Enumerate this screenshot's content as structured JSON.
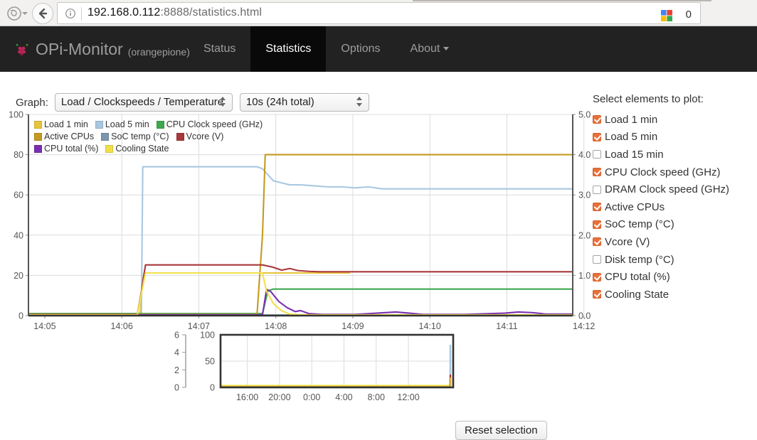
{
  "browser": {
    "url_host": "192.168.0.112",
    "url_rest": ":8888/statistics.html",
    "badge_count": "0",
    "icons": {
      "firefox": "firefox-logo-icon",
      "back": "back-arrow-icon",
      "info": "page-info-icon",
      "extension": "extension-icon"
    }
  },
  "navbar": {
    "brand": "OPi-Monitor",
    "brand_sub": "(orangepione)",
    "items": [
      {
        "label": "Status",
        "active": false
      },
      {
        "label": "Statistics",
        "active": true
      },
      {
        "label": "Options",
        "active": false
      },
      {
        "label": "About",
        "active": false,
        "caret": true
      }
    ]
  },
  "controls": {
    "graph_label": "Graph:",
    "graph_select": "Load / Clockspeeds / Temperature",
    "interval_select": "10s (24h total)"
  },
  "plot_selector": {
    "title": "Select elements to plot:",
    "items": [
      {
        "label": "Load 1 min",
        "checked": true
      },
      {
        "label": "Load 5 min",
        "checked": true
      },
      {
        "label": "Load 15 min",
        "checked": false
      },
      {
        "label": "CPU Clock speed (GHz)",
        "checked": true
      },
      {
        "label": "DRAM Clock speed (GHz)",
        "checked": false
      },
      {
        "label": "Active CPUs",
        "checked": true
      },
      {
        "label": "SoC temp (°C)",
        "checked": true
      },
      {
        "label": "Vcore (V)",
        "checked": true
      },
      {
        "label": "Disk temp (°C)",
        "checked": false
      },
      {
        "label": "CPU total (%)",
        "checked": true
      },
      {
        "label": "Cooling State",
        "checked": true
      }
    ]
  },
  "buttons": {
    "reset_selection": "Reset selection"
  },
  "chart_data": {
    "type": "line",
    "title": "",
    "xlabel": "",
    "ylabel": "",
    "grid": true,
    "legend_position": "top-left",
    "x_ticks": [
      "14:05",
      "14:06",
      "14:07",
      "14:08",
      "14:09",
      "14:10",
      "14:11",
      "14:12"
    ],
    "y_left_ticks": [
      "0",
      "20",
      "40",
      "60",
      "80",
      "100"
    ],
    "y_right_ticks": [
      "0.0",
      "1.0",
      "2.0",
      "3.0",
      "4.0",
      "5.0"
    ],
    "ylim_left": [
      0,
      100
    ],
    "ylim_right": [
      0.0,
      5.0
    ],
    "xlim": [
      "14:04:30",
      "14:12:40"
    ],
    "series": [
      {
        "name": "Load 1 min",
        "color": "#e8c33c",
        "axis": "right",
        "points": [
          [
            0,
            0.02
          ],
          [
            0.24,
            0.02
          ],
          [
            0.3,
            0.03
          ],
          [
            0.31,
            0.02
          ],
          [
            0.33,
            0.04
          ],
          [
            0.35,
            0.02
          ],
          [
            0.4,
            0.05
          ],
          [
            0.41,
            0.03
          ],
          [
            0.42,
            0.9
          ],
          [
            0.425,
            1.06
          ],
          [
            0.43,
            1.06
          ],
          [
            0.5,
            1.06
          ],
          [
            0.6,
            1.06
          ],
          [
            0.7,
            1.06
          ],
          [
            0.8,
            1.06
          ],
          [
            0.9,
            1.06
          ],
          [
            1.0,
            1.06
          ],
          [
            1.05,
            1.06
          ],
          [
            1.08,
            1.06
          ],
          [
            1.1,
            1.06
          ],
          [
            1.12,
            1.06
          ],
          [
            1.15,
            1.06
          ],
          [
            1.18,
            1.06
          ]
        ]
      },
      {
        "name": "Load 5 min",
        "color": "#a8c8e0",
        "axis": "left",
        "points": [
          [
            0,
            0.4
          ],
          [
            0.24,
            0.4
          ],
          [
            0.3,
            0.4
          ],
          [
            0.4,
            0.4
          ],
          [
            0.415,
            0.4
          ],
          [
            0.42,
            74
          ],
          [
            0.43,
            74
          ],
          [
            0.5,
            74
          ],
          [
            0.6,
            74
          ],
          [
            0.7,
            74
          ],
          [
            0.8,
            74
          ],
          [
            0.84,
            74
          ],
          [
            0.86,
            73
          ],
          [
            0.88,
            70
          ],
          [
            0.9,
            67
          ],
          [
            0.93,
            66
          ],
          [
            0.96,
            65
          ],
          [
            1.0,
            65
          ],
          [
            1.05,
            64.5
          ],
          [
            1.1,
            64
          ],
          [
            1.15,
            64
          ],
          [
            1.2,
            63.5
          ],
          [
            1.25,
            64
          ],
          [
            1.3,
            63
          ],
          [
            1.35,
            63
          ],
          [
            1.4,
            63
          ],
          [
            1.45,
            63
          ],
          [
            1.5,
            63
          ],
          [
            1.6,
            63
          ],
          [
            1.7,
            63
          ],
          [
            1.8,
            63
          ],
          [
            1.9,
            63
          ],
          [
            2.0,
            63
          ]
        ]
      },
      {
        "name": "CPU Clock speed (GHz)",
        "color": "#3ea84f",
        "axis": "right",
        "points": [
          [
            0,
            0.05
          ],
          [
            0.4,
            0.05
          ],
          [
            0.86,
            0.05
          ],
          [
            0.88,
            0.62
          ],
          [
            0.9,
            0.66
          ],
          [
            0.93,
            0.66
          ],
          [
            1.0,
            0.66
          ],
          [
            1.2,
            0.66
          ],
          [
            2.0,
            0.66
          ]
        ]
      },
      {
        "name": "Active CPUs",
        "color": "#c49a20",
        "axis": "right",
        "points": [
          [
            0,
            0.03
          ],
          [
            0.4,
            0.03
          ],
          [
            0.84,
            0.03
          ],
          [
            0.86,
            2.0
          ],
          [
            0.87,
            4.0
          ],
          [
            0.875,
            4.0
          ],
          [
            0.9,
            4.0
          ],
          [
            1.0,
            4.0
          ],
          [
            1.5,
            4.0
          ],
          [
            2.0,
            4.0
          ]
        ]
      },
      {
        "name": "SoC temp (°C)",
        "color": "#7b96ad",
        "axis": "left",
        "points": [
          [
            0,
            0.3
          ],
          [
            0.4,
            0.3
          ],
          [
            0.42,
            0.3
          ],
          [
            1.0,
            0.3
          ],
          [
            2.0,
            0.3
          ]
        ]
      },
      {
        "name": "Vcore (V)",
        "color": "#a8383b",
        "axis": "right",
        "points": [
          [
            0,
            0.03
          ],
          [
            0.4,
            0.03
          ],
          [
            0.415,
            0.6
          ],
          [
            0.43,
            1.26
          ],
          [
            0.5,
            1.26
          ],
          [
            0.7,
            1.26
          ],
          [
            0.84,
            1.26
          ],
          [
            0.86,
            1.26
          ],
          [
            0.9,
            1.2
          ],
          [
            0.93,
            1.13
          ],
          [
            0.96,
            1.17
          ],
          [
            0.99,
            1.12
          ],
          [
            1.03,
            1.1
          ],
          [
            1.07,
            1.09
          ],
          [
            1.1,
            1.09
          ],
          [
            1.2,
            1.09
          ],
          [
            1.5,
            1.09
          ],
          [
            2.0,
            1.09
          ]
        ]
      },
      {
        "name": "CPU total (%)",
        "color": "#7a2fb0",
        "axis": "left",
        "points": [
          [
            0,
            0.25
          ],
          [
            0.4,
            0.25
          ],
          [
            0.42,
            0.4
          ],
          [
            0.84,
            0.4
          ],
          [
            0.86,
            0.4
          ],
          [
            0.875,
            13
          ],
          [
            0.89,
            12
          ],
          [
            0.92,
            7
          ],
          [
            0.95,
            4
          ],
          [
            0.98,
            2
          ],
          [
            1.0,
            2.5
          ],
          [
            1.03,
            1
          ],
          [
            1.08,
            0.6
          ],
          [
            1.2,
            0.6
          ],
          [
            1.3,
            1.4
          ],
          [
            1.35,
            1.8
          ],
          [
            1.4,
            1.2
          ],
          [
            1.45,
            0.6
          ],
          [
            1.6,
            0.6
          ],
          [
            1.75,
            1.2
          ],
          [
            1.8,
            1.8
          ],
          [
            1.85,
            1.5
          ],
          [
            1.9,
            0.8
          ],
          [
            2.0,
            0.8
          ]
        ]
      },
      {
        "name": "Cooling State",
        "color": "#f2e04a",
        "axis": "right",
        "points": [
          [
            0,
            0.02
          ],
          [
            0.4,
            0.02
          ],
          [
            0.415,
            0.55
          ],
          [
            0.43,
            1.06
          ],
          [
            0.5,
            1.06
          ],
          [
            0.7,
            1.06
          ],
          [
            0.84,
            1.06
          ],
          [
            0.86,
            1.06
          ],
          [
            0.875,
            0.6
          ],
          [
            0.9,
            0.3
          ],
          [
            0.93,
            0.12
          ],
          [
            0.96,
            0.04
          ],
          [
            1.0,
            0.02
          ],
          [
            1.5,
            0.02
          ],
          [
            2.0,
            0.02
          ]
        ]
      }
    ]
  },
  "mini_chart": {
    "type": "line",
    "y_left_ticks": [
      "0",
      "2",
      "4",
      "6"
    ],
    "y_right_ticks": [
      "0",
      "50",
      "100"
    ],
    "x_ticks": [
      "16:00",
      "20:00",
      "0:00",
      "4:00",
      "8:00",
      "12:00"
    ],
    "ylim_left": [
      0,
      6
    ],
    "ylim_right": [
      0,
      100
    ],
    "selection": "full",
    "series": [
      {
        "name": "Cooling State",
        "color": "#f2e04a"
      },
      {
        "name": "Active CPUs",
        "color": "#c49a20"
      },
      {
        "name": "Load 5 min",
        "color": "#a8c8e0"
      },
      {
        "name": "Vcore (V)",
        "color": "#a8383b"
      }
    ]
  }
}
